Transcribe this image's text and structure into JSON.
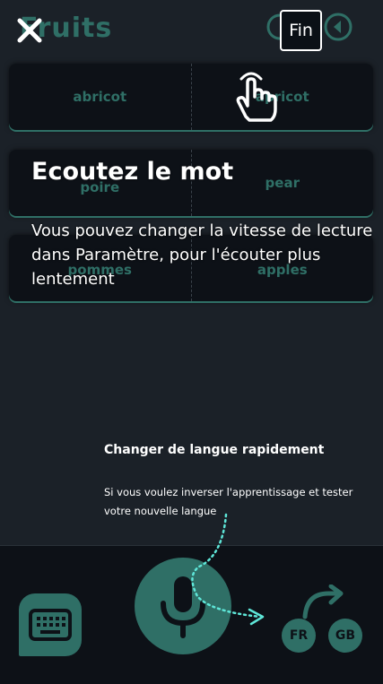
{
  "header": {
    "title": "Fruits",
    "fin_label": "Fin"
  },
  "cards": [
    {
      "left": "abricot",
      "right": "apricot"
    },
    {
      "left": "poire",
      "right": "pear"
    },
    {
      "left": "pommes",
      "right": "apples"
    }
  ],
  "tutorial": {
    "title": "Ecoutez le mot",
    "description": "Vous pouvez changer la vitesse de lecture dans Paramètre, pour l'écouter plus lentement"
  },
  "language_hint": {
    "title": "Changer de langue rapidement",
    "description": "Si vous voulez inverser l'apprentissage et tester votre nouvelle langue"
  },
  "bottom": {
    "source_lang": "FR",
    "target_lang": "GB"
  },
  "colors": {
    "accent": "#2f6f66",
    "background": "#1b2128",
    "card": "#0d1117",
    "arrow": "#5ee6d8"
  }
}
